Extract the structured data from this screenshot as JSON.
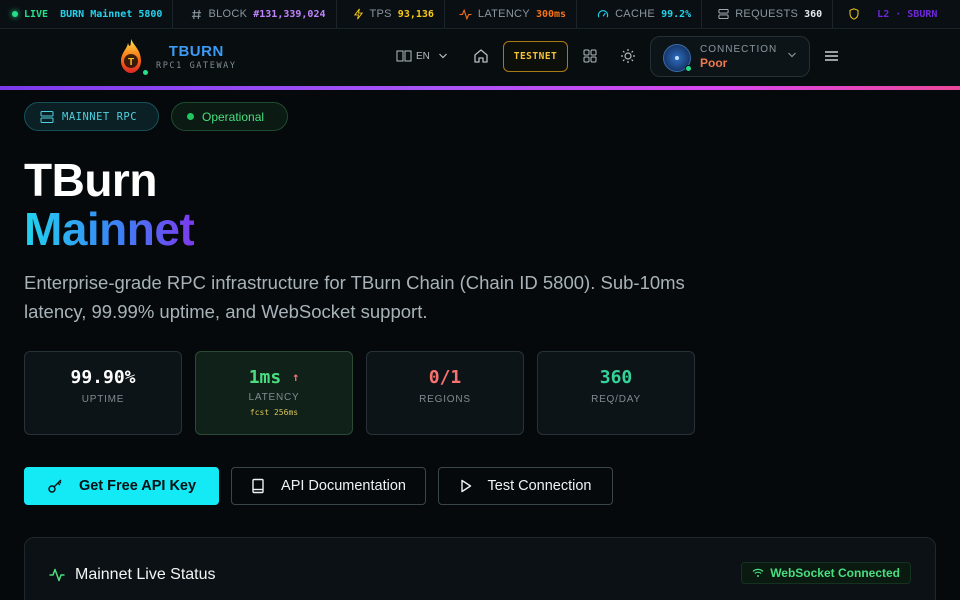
{
  "ticker": {
    "live": "LIVE",
    "network": "BURN Mainnet 5800",
    "items": [
      {
        "icon": "hash-icon",
        "label": "BLOCK",
        "value": "#131,339,024",
        "color": "#c084fc"
      },
      {
        "icon": "bolt-icon",
        "label": "TPS",
        "value": "93,136",
        "color": "#facc15"
      },
      {
        "icon": "activity-icon",
        "label": "LATENCY",
        "value": "300ms",
        "color": "#f97316"
      },
      {
        "icon": "gauge-icon",
        "label": "CACHE",
        "value": "99.2%",
        "color": "#22d3ee"
      },
      {
        "icon": "server-icon",
        "label": "REQUESTS",
        "value": "360",
        "color": "#e7edf0"
      }
    ],
    "extra": "L2 · SBURN"
  },
  "header": {
    "brand_title": "TBURN",
    "brand_subtitle": "RPC1 GATEWAY",
    "logo_letter": "T",
    "lang": "EN",
    "testnet_label": "TESTNET",
    "connection_label": "CONNECTION",
    "connection_value": "Poor"
  },
  "hero": {
    "badge_rpc": "MAINNET RPC",
    "badge_status": "Operational",
    "title_line1": "TBurn",
    "title_line2": "Mainnet",
    "description": "Enterprise-grade RPC infrastructure for TBurn Chain (Chain ID 5800). Sub-10ms latency, 99.99% uptime, and WebSocket support."
  },
  "stats": [
    {
      "value": "99.90%",
      "label": "UPTIME",
      "color": "#ffffff"
    },
    {
      "value": "1ms",
      "label": "LATENCY",
      "sub": "fcst 256ms",
      "color": "#4ade80",
      "trend": "↑"
    },
    {
      "value": "0/1",
      "label": "REGIONS",
      "color": "#f87171"
    },
    {
      "value": "360",
      "label": "REQ/DAY",
      "color": "#34d399"
    }
  ],
  "actions": {
    "primary": "Get Free API Key",
    "docs": "API Documentation",
    "test": "Test Connection"
  },
  "live_status": {
    "title": "Mainnet Live Status",
    "ws_badge": "WebSocket Connected"
  }
}
